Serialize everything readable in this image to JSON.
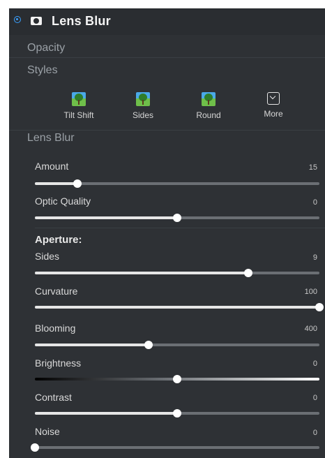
{
  "header": {
    "title": "Lens Blur",
    "icon": "mask-icon",
    "radio_icon": "radio-selected-icon",
    "accent_color": "#3aa0ff"
  },
  "sections": {
    "opacity": "Opacity",
    "styles": "Styles"
  },
  "styles": [
    {
      "label": "Tilt Shift",
      "icon": "tree-thumbnail-icon"
    },
    {
      "label": "Sides",
      "icon": "tree-thumbnail-icon"
    },
    {
      "label": "Round",
      "icon": "tree-thumbnail-icon"
    },
    {
      "label": "More",
      "icon": "chevron-down-box-icon"
    }
  ],
  "group_title": "Lens Blur",
  "aperture_heading": "Aperture:",
  "sliders": [
    {
      "label": "Amount",
      "value": "15",
      "level": 0.15
    },
    {
      "label": "Optic Quality",
      "value": "0",
      "level": 0.5
    },
    {
      "label": "Sides",
      "value": "9",
      "level": 0.75
    },
    {
      "label": "Curvature",
      "value": "100",
      "level": 1.0
    },
    {
      "label": "Blooming",
      "value": "400",
      "level": 0.4
    },
    {
      "label": "Brightness",
      "value": "0",
      "level": 0.5
    },
    {
      "label": "Contrast",
      "value": "0",
      "level": 0.5
    },
    {
      "label": "Noise",
      "value": "0",
      "level": 0.0
    }
  ]
}
